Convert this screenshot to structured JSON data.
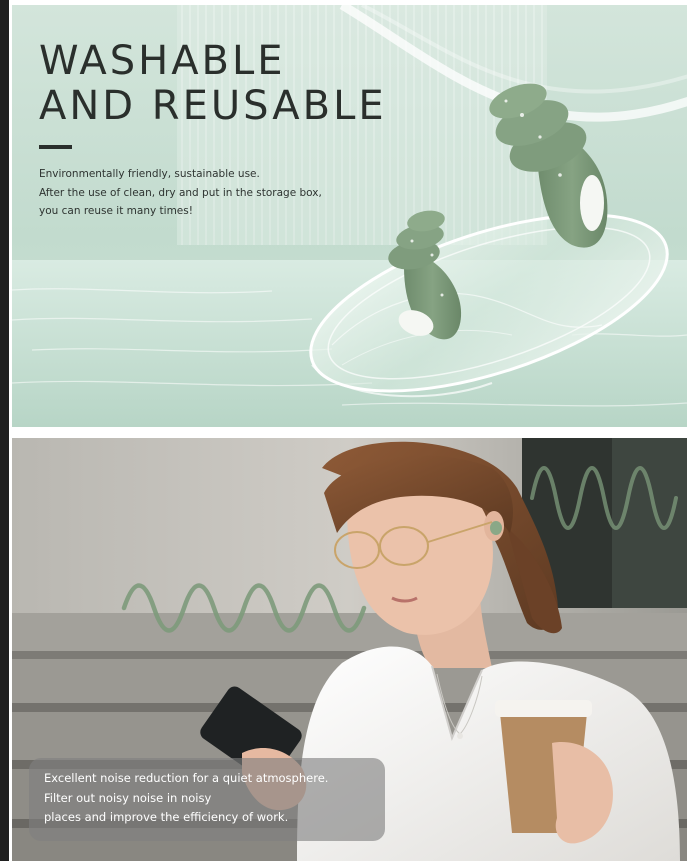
{
  "hero": {
    "title_line_1": "WASHABLE",
    "title_line_2": "AND REUSABLE",
    "description": [
      "Environmentally friendly, sustainable use.",
      "After the use of clean, dry and put in the storage box,",
      "you can reuse it many times!"
    ]
  },
  "lifestyle": {
    "caption": [
      "Excellent noise reduction for a quiet atmosphere.",
      "Filter out noisy noise in noisy",
      "places and improve the efficiency of work."
    ]
  },
  "colors": {
    "sage_green": "#7d9a7b",
    "mint_background": "#c4dccf",
    "headline_text": "#2a2f2c",
    "caption_box": "#808080"
  }
}
